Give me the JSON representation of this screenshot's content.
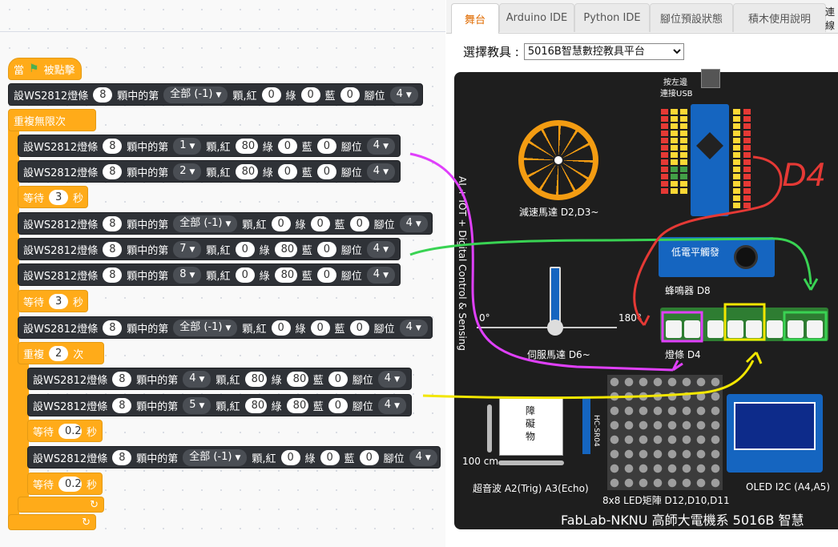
{
  "workspace": {
    "hat_label": "當 被點擊",
    "set_word": "設WS2812燈條",
    "of_word": "顆中的第",
    "red_word": "顆,紅",
    "green_word": "綠",
    "blue_word": "藍",
    "pin_word": "腳位",
    "forever_label": "重複無限次",
    "repeat_label": "重複",
    "repeat_times_word": "次",
    "wait_label": "等待",
    "wait_unit": "秒",
    "blocks": [
      {
        "count": "8",
        "index": "全部 (-1)",
        "red": "0",
        "green": "0",
        "blue": "0",
        "pin": "4"
      },
      {
        "count": "8",
        "index": "1",
        "red": "80",
        "green": "0",
        "blue": "0",
        "pin": "4"
      },
      {
        "count": "8",
        "index": "2",
        "red": "80",
        "green": "0",
        "blue": "0",
        "pin": "4"
      },
      {
        "count": "8",
        "index": "全部 (-1)",
        "red": "0",
        "green": "0",
        "blue": "0",
        "pin": "4"
      },
      {
        "count": "8",
        "index": "7",
        "red": "0",
        "green": "80",
        "blue": "0",
        "pin": "4"
      },
      {
        "count": "8",
        "index": "8",
        "red": "0",
        "green": "80",
        "blue": "0",
        "pin": "4"
      },
      {
        "count": "8",
        "index": "全部 (-1)",
        "red": "0",
        "green": "0",
        "blue": "0",
        "pin": "4"
      },
      {
        "count": "8",
        "index": "4",
        "red": "80",
        "green": "80",
        "blue": "0",
        "pin": "4"
      },
      {
        "count": "8",
        "index": "5",
        "red": "80",
        "green": "80",
        "blue": "0",
        "pin": "4"
      },
      {
        "count": "8",
        "index": "全部 (-1)",
        "red": "0",
        "green": "0",
        "blue": "0",
        "pin": "4"
      }
    ],
    "waits": [
      "3",
      "3",
      "0.2",
      "0.2"
    ],
    "repeat_count": "2"
  },
  "tabs": [
    "舞台",
    "Arduino IDE",
    "Python IDE",
    "腳位預設狀態",
    "積木使用說明"
  ],
  "tab_edge_text": "連線",
  "selector": {
    "label": "選擇教具 :",
    "value": "5016B智慧數控教具平台"
  },
  "board": {
    "usb_label_1": "按左邊",
    "usb_label_2": "連接USB",
    "motor_label": "減速馬達 D2,D3~",
    "servo_label": "伺服馬達 D6~",
    "servo_min": "0°",
    "servo_max": "180°",
    "buzzer_button": "低電平觸發",
    "buzzer_label": "蜂鳴器 D8",
    "strip_label": "燈條 D4",
    "sonar_obstacle": "障礙物",
    "sonar_distance": "100 cm",
    "sonar_module": "HC-SR04",
    "sonar_label": "超音波 A2(Trig) A3(Echo)",
    "matrix_label": "8x8 LED矩陣 D12,D10,D11",
    "oled_label": "OLED I2C (A4,A5)",
    "vertical_text": "AI + IOT + Digital Control & Sensing",
    "footer": "FabLab-NKNU   高師大電機系 5016B 智慧",
    "annotation_d4": "D4"
  },
  "colors": {
    "block_dark": "#2f3237",
    "block_orange": "#ffab19",
    "active_tab": "#e06b00",
    "board_bg": "#1e1e1e",
    "pcb_blue": "#1565c0",
    "strip_green": "#2e7d32",
    "annot_red": "#e53935",
    "annot_magenta": "#e040fb",
    "annot_green": "#39d353",
    "annot_yellow": "#f2e600"
  }
}
